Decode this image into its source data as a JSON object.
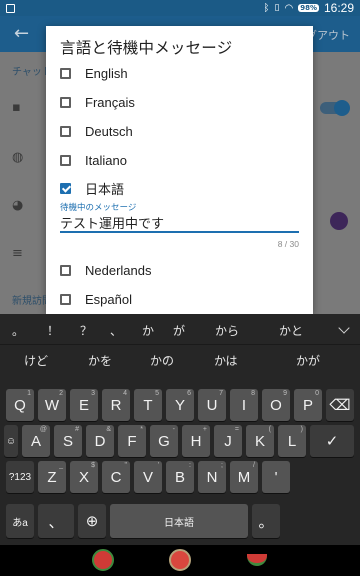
{
  "status_bar": {
    "battery": "98%",
    "time": "16:29"
  },
  "background_app": {
    "logout_label": "ログアウト",
    "chat_section_label": "チャット",
    "new_visit_label": "新規訪問"
  },
  "dialog": {
    "title": "言語と待機中メッセージ",
    "languages": [
      {
        "label": "English",
        "checked": false
      },
      {
        "label": "Français",
        "checked": false
      },
      {
        "label": "Deutsch",
        "checked": false
      },
      {
        "label": "Italiano",
        "checked": false
      },
      {
        "label": "日本語",
        "checked": true
      },
      {
        "label": "Nederlands",
        "checked": false
      },
      {
        "label": "Español",
        "checked": false
      }
    ],
    "away_message_label": "待機中のメッセージ",
    "away_message_value": "テスト運用中です",
    "char_counter": "8 / 30"
  },
  "keyboard": {
    "suggestions_row1": [
      "。",
      "！",
      "？",
      "、",
      "か",
      "が",
      "から",
      "かと"
    ],
    "suggestions_row2": [
      "けど",
      "かを",
      "かの",
      "かは",
      "かが"
    ],
    "row1": [
      {
        "label": "Q",
        "sub": "1"
      },
      {
        "label": "W",
        "sub": "2"
      },
      {
        "label": "E",
        "sub": "3"
      },
      {
        "label": "R",
        "sub": "4"
      },
      {
        "label": "T",
        "sub": "5"
      },
      {
        "label": "Y",
        "sub": "6"
      },
      {
        "label": "U",
        "sub": "7"
      },
      {
        "label": "I",
        "sub": "8"
      },
      {
        "label": "O",
        "sub": "9"
      },
      {
        "label": "P",
        "sub": "0"
      }
    ],
    "backspace": "⌫",
    "row2_left": "☺",
    "row2": [
      "A",
      "S",
      "D",
      "F",
      "G",
      "H",
      "J",
      "K",
      "L"
    ],
    "row2_subs": [
      "@",
      "#",
      "&",
      "*",
      "-",
      "+",
      "=",
      "(",
      ")"
    ],
    "enter": "✓",
    "row3_left": "?123",
    "row3": [
      "Z",
      "X",
      "C",
      "V",
      "B",
      "N",
      "M"
    ],
    "row3_subs": [
      "_",
      "$",
      "\"",
      "'",
      ":",
      ";",
      "/"
    ],
    "row3_right": "'",
    "mode_key": "あa",
    "comma_key": "、",
    "globe_key": "⊕",
    "space_label": "日本語",
    "period_key": "。"
  }
}
